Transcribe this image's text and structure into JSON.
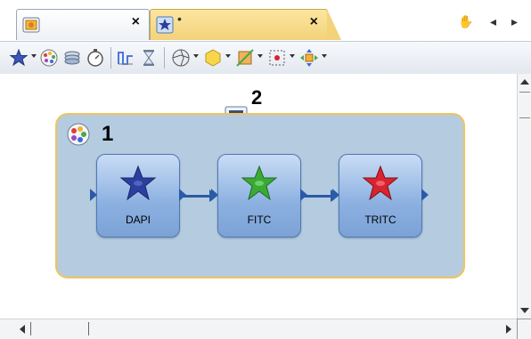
{
  "tabs": [
    {
      "icon": "workspace-document-icon",
      "close_label": "×"
    },
    {
      "icon": "microscopy-star-icon",
      "modified_marker": "•",
      "close_label": "×",
      "active": true
    }
  ],
  "tab_nav": {
    "hand_icon": "✋",
    "prev": "◂",
    "next": "▸"
  },
  "toolbar": {
    "items": [
      "add-channel-star-icon",
      "color-palette-icon",
      "layers-icon",
      "timer-icon",
      "step-function-icon",
      "hourglass-icon",
      "aperture-icon",
      "hexagon-icon",
      "filter-icon",
      "scan-region-icon",
      "move-arrows-icon"
    ]
  },
  "canvas": {
    "group_label": "1",
    "comment_label": "2",
    "nodes": [
      {
        "label": "DAPI",
        "color": "#2b3f9e"
      },
      {
        "label": "FITC",
        "color": "#3aaa35"
      },
      {
        "label": "TRITC",
        "color": "#d8242e"
      }
    ]
  },
  "colors": {
    "group_fill": "#b5cce0",
    "group_border": "#f2c35a",
    "connector": "#2a5aa8",
    "active_tab": "#f3d27a"
  }
}
